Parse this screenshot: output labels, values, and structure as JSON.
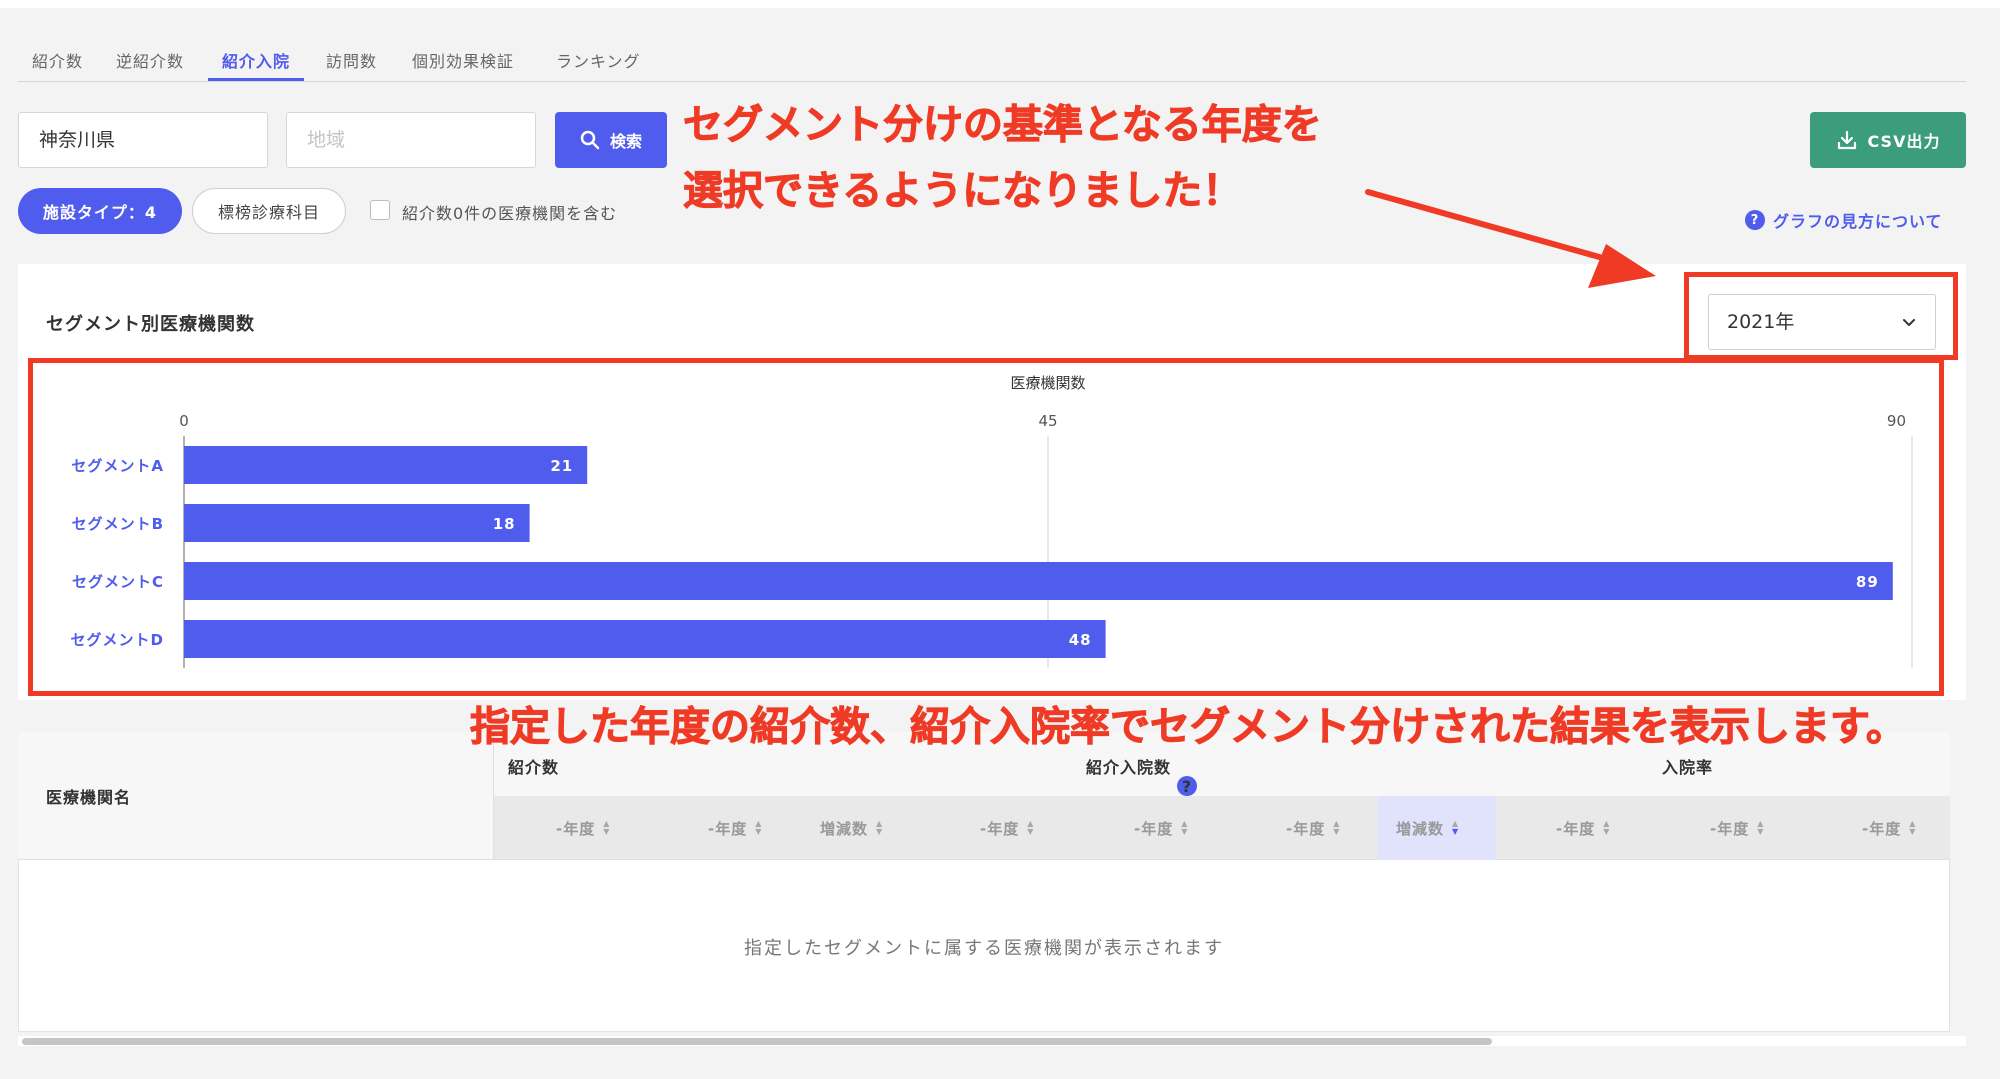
{
  "tabs": [
    {
      "label": "紹介数",
      "active": false
    },
    {
      "label": "逆紹介数",
      "active": false
    },
    {
      "label": "紹介入院",
      "active": true
    },
    {
      "label": "訪問数",
      "active": false
    },
    {
      "label": "個別効果検証",
      "active": false
    },
    {
      "label": "ランキング",
      "active": false
    }
  ],
  "search": {
    "prefecture_value": "神奈川県",
    "region_placeholder": "地域",
    "search_label": "検索",
    "csv_label": "CSV出力"
  },
  "filters": {
    "facility_type": "施設タイプ：4",
    "department": "標榜診療科目",
    "include_zero_label": "紹介数0件の医療機関を含む"
  },
  "help_link": "グラフの見方について",
  "annotations": {
    "line1": "セグメント分けの基準となる年度を",
    "line2": "選択できるようになりました！",
    "line3": "指定した年度の紹介数、紹介入院率でセグメント分けされた結果を表示します。"
  },
  "chart_card": {
    "title": "セグメント別医療機関数",
    "year_selected": "2021年"
  },
  "chart_data": {
    "type": "bar",
    "orientation": "horizontal",
    "title": "医療機関数",
    "categories": [
      "セグメントA",
      "セグメントB",
      "セグメントC",
      "セグメントD"
    ],
    "values": [
      21,
      18,
      89,
      48
    ],
    "xlim": [
      0,
      90
    ],
    "ticks": [
      0,
      45,
      90
    ],
    "bar_color": "#4f5ced",
    "grid": true
  },
  "table": {
    "name_header": "医療機関名",
    "groups": [
      {
        "label": "紹介数"
      },
      {
        "label": "紹介入院数",
        "help": "?"
      },
      {
        "label": "入院率"
      }
    ],
    "sub_headers": [
      "-年度",
      "-年度",
      "増減数",
      "-年度",
      "-年度",
      "-年度",
      "増減数",
      "-年度",
      "-年度",
      "-年度"
    ],
    "empty_message": "指定したセグメントに属する医療機関が表示されます"
  },
  "colors": {
    "accent": "#4f5ced",
    "csv_green": "#3b9d7b",
    "annotation_red": "#ef3a25"
  }
}
